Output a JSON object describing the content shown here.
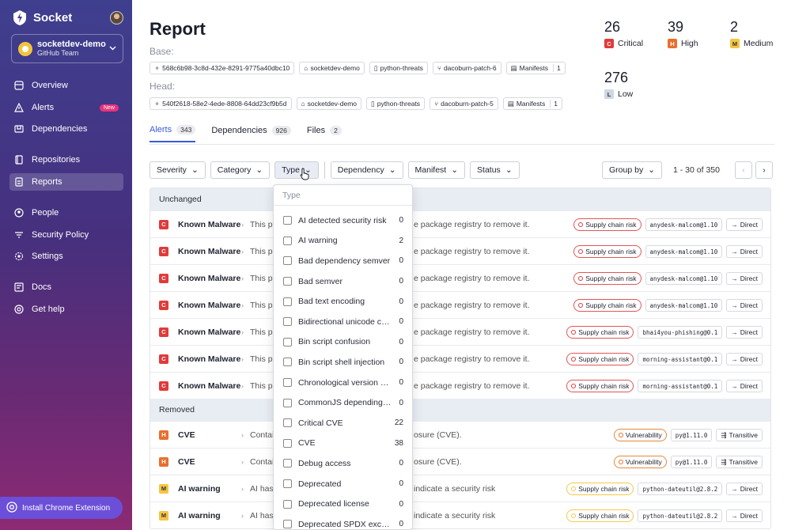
{
  "sidebar": {
    "brand": "Socket",
    "org": {
      "name": "socketdev-demo",
      "sub": "GitHub Team"
    },
    "items": [
      {
        "label": "Overview",
        "icon": "overview-icon"
      },
      {
        "label": "Alerts",
        "icon": "alert-triangle-icon",
        "badge": "New"
      },
      {
        "label": "Dependencies",
        "icon": "package-icon"
      },
      {
        "label": "Repositories",
        "icon": "book-icon"
      },
      {
        "label": "Reports",
        "icon": "report-icon"
      },
      {
        "label": "People",
        "icon": "people-icon"
      },
      {
        "label": "Security Policy",
        "icon": "shield-icon"
      },
      {
        "label": "Settings",
        "icon": "gear-icon"
      },
      {
        "label": "Docs",
        "icon": "docs-icon"
      },
      {
        "label": "Get help",
        "icon": "help-icon"
      }
    ],
    "chrome_button": "Install Chrome Extension"
  },
  "report": {
    "title": "Report",
    "base_label": "Base:",
    "head_label": "Head:",
    "base": {
      "commit": "568c6b98-3c8d-432e-8291-9775a40dbc10",
      "org": "socketdev-demo",
      "repo": "python-threats",
      "branch": "dacoburn-patch-6",
      "manifests_label": "Manifests",
      "manifests_count": "1"
    },
    "head": {
      "commit": "540f2618-58e2-4ede-8808-64dd23cf9b5d",
      "org": "socketdev-demo",
      "repo": "python-threats",
      "branch": "dacoburn-patch-5",
      "manifests_label": "Manifests",
      "manifests_count": "1"
    }
  },
  "severity": {
    "critical": {
      "count": "26",
      "letter": "C",
      "label": "Critical"
    },
    "high": {
      "count": "39",
      "letter": "H",
      "label": "High"
    },
    "medium": {
      "count": "2",
      "letter": "M",
      "label": "Medium"
    },
    "low": {
      "count": "276",
      "letter": "L",
      "label": "Low"
    }
  },
  "tabs": [
    {
      "label": "Alerts",
      "count": "343"
    },
    {
      "label": "Dependencies",
      "count": "926"
    },
    {
      "label": "Files",
      "count": "2"
    }
  ],
  "filters": {
    "severity": "Severity",
    "category": "Category",
    "type": "Type",
    "dependency": "Dependency",
    "manifest": "Manifest",
    "status": "Status",
    "group_by": "Group by",
    "pagination": "1 - 30 of 350"
  },
  "sections": {
    "unchanged": "Unchanged",
    "removed": "Removed"
  },
  "rows": [
    {
      "sev": "C",
      "name": "Known Malware",
      "desc": "This p",
      "desc2": "e package registry to remove it.",
      "tag": "Supply chain risk",
      "pkg": "anydesk-malcom@1.10",
      "rel": "Direct"
    },
    {
      "sev": "C",
      "name": "Known Malware",
      "desc": "This p",
      "desc2": "e package registry to remove it.",
      "tag": "Supply chain risk",
      "pkg": "anydesk-malcom@1.10",
      "rel": "Direct"
    },
    {
      "sev": "C",
      "name": "Known Malware",
      "desc": "This p",
      "desc2": "e package registry to remove it.",
      "tag": "Supply chain risk",
      "pkg": "anydesk-malcom@1.10",
      "rel": "Direct"
    },
    {
      "sev": "C",
      "name": "Known Malware",
      "desc": "This p",
      "desc2": "e package registry to remove it.",
      "tag": "Supply chain risk",
      "pkg": "anydesk-malcom@1.10",
      "rel": "Direct"
    },
    {
      "sev": "C",
      "name": "Known Malware",
      "desc": "This p",
      "desc2": "e package registry to remove it.",
      "tag": "Supply chain risk",
      "pkg": "bhai4you-phishing@0.1",
      "rel": "Direct"
    },
    {
      "sev": "C",
      "name": "Known Malware",
      "desc": "This p",
      "desc2": "e package registry to remove it.",
      "tag": "Supply chain risk",
      "pkg": "morning-assistant@0.1",
      "rel": "Direct"
    },
    {
      "sev": "C",
      "name": "Known Malware",
      "desc": "This p",
      "desc2": "e package registry to remove it.",
      "tag": "Supply chain risk",
      "pkg": "morning-assistant@0.1",
      "rel": "Direct"
    }
  ],
  "removed_rows": [
    {
      "sev": "H",
      "name": "CVE",
      "desc": "Contains a high s",
      "desc2": "osure (CVE).",
      "tag": "Vulnerability",
      "pkg": "py@1.11.0",
      "rel": "Transitive"
    },
    {
      "sev": "H",
      "name": "CVE",
      "desc": "Contains a high s",
      "desc2": "osure (CVE).",
      "tag": "Vulnerability",
      "pkg": "py@1.11.0",
      "rel": "Transitive"
    },
    {
      "sev": "M",
      "name": "AI warning",
      "desc": "AI has four",
      "desc2": "indicate a security risk",
      "tag": "Supply chain risk",
      "pkg": "python-dateutil@2.8.2",
      "rel": "Direct"
    },
    {
      "sev": "M",
      "name": "AI warning",
      "desc": "AI has four",
      "desc2": "indicate a security risk",
      "tag": "Supply chain risk",
      "pkg": "python-dateutil@2.8.2",
      "rel": "Direct"
    }
  ],
  "type_dropdown": {
    "placeholder": "Type",
    "items": [
      {
        "label": "AI detected security risk",
        "count": "0"
      },
      {
        "label": "AI warning",
        "count": "2"
      },
      {
        "label": "Bad dependency semver",
        "count": "0"
      },
      {
        "label": "Bad semver",
        "count": "0"
      },
      {
        "label": "Bad text encoding",
        "count": "0"
      },
      {
        "label": "Bidirectional unicode co...",
        "count": "0"
      },
      {
        "label": "Bin script confusion",
        "count": "0"
      },
      {
        "label": "Bin script shell injection",
        "count": "0"
      },
      {
        "label": "Chronological version an...",
        "count": "0"
      },
      {
        "label": "CommonJS depending o...",
        "count": "0"
      },
      {
        "label": "Critical CVE",
        "count": "22"
      },
      {
        "label": "CVE",
        "count": "38"
      },
      {
        "label": "Debug access",
        "count": "0"
      },
      {
        "label": "Deprecated",
        "count": "0"
      },
      {
        "label": "Deprecated license",
        "count": "0"
      },
      {
        "label": "Deprecated SPDX excep...",
        "count": "0"
      }
    ]
  },
  "colors": {
    "critical": "#e03b3b",
    "high": "#e96f2c",
    "medium": "#f5c542",
    "accent": "#3b5bdb"
  }
}
